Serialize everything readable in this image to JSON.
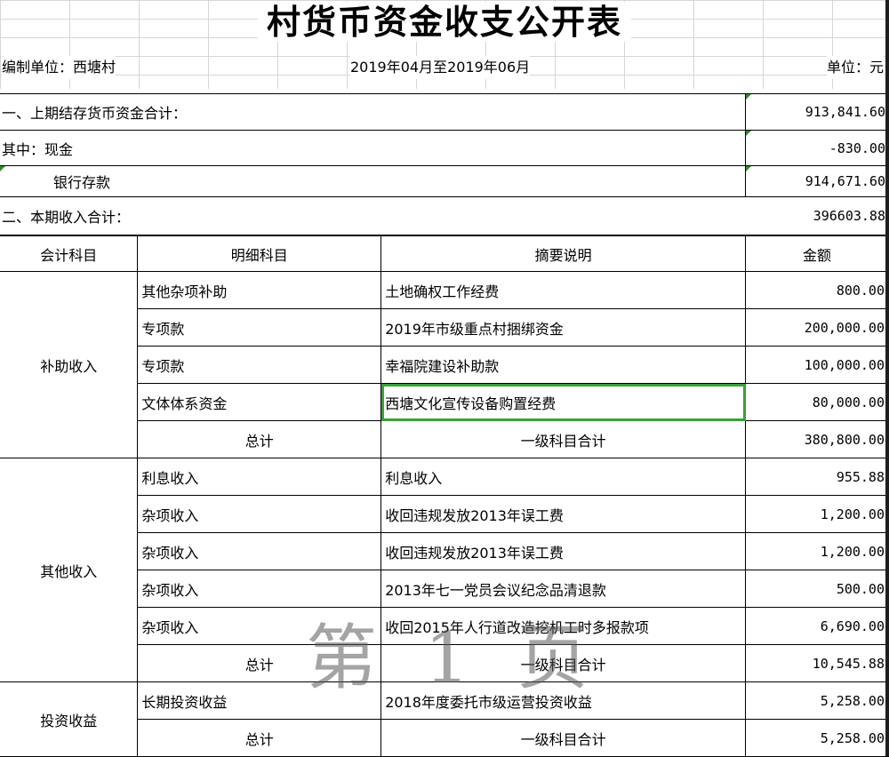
{
  "title": "村货币资金收支公开表",
  "meta": {
    "unit_org": "编制单位：西塘村",
    "period": "2019年04月至2019年06月",
    "currency_unit": "单位：元"
  },
  "summary": [
    {
      "label": "一、上期结存货币资金合计：",
      "amount": "913,841.60"
    },
    {
      "label": "其中：现金",
      "amount": "-830.00"
    },
    {
      "label": "银行存款",
      "amount": "914,671.60"
    },
    {
      "label": "二、本期收入合计：",
      "amount": "396603.88"
    }
  ],
  "table": {
    "headers": [
      "会计科目",
      "明细科目",
      "摘要说明",
      "金额"
    ],
    "groups": [
      {
        "category": "补助收入",
        "rows": [
          {
            "detail": "其他杂项补助",
            "desc": "土地确权工作经费",
            "amount": "800.00"
          },
          {
            "detail": "专项款",
            "desc": "2019年市级重点村捆绑资金",
            "amount": "200,000.00"
          },
          {
            "detail": "专项款",
            "desc": "幸福院建设补助款",
            "amount": "100,000.00"
          },
          {
            "detail": "文体体系资金",
            "desc": "西塘文化宣传设备购置经费",
            "amount": "80,000.00"
          }
        ],
        "total": {
          "label": "总计",
          "desc": "一级科目合计",
          "amount": "380,800.00"
        }
      },
      {
        "category": "其他收入",
        "rows": [
          {
            "detail": "利息收入",
            "desc": "利息收入",
            "amount": "955.88"
          },
          {
            "detail": "杂项收入",
            "desc": "收回违规发放2013年误工费",
            "amount": "1,200.00"
          },
          {
            "detail": "杂项收入",
            "desc": "收回违规发放2013年误工费",
            "amount": "1,200.00"
          },
          {
            "detail": "杂项收入",
            "desc": "2013年七一党员会议纪念品清退款",
            "amount": "500.00"
          },
          {
            "detail": "杂项收入",
            "desc": "收回2015年人行道改造挖机工时多报款项",
            "amount": "6,690.00"
          }
        ],
        "total": {
          "label": "总计",
          "desc": "一级科目合计",
          "amount": "10,545.88"
        }
      },
      {
        "category": "投资收益",
        "rows": [
          {
            "detail": "长期投资收益",
            "desc": "2018年度委托市级运营投资收益",
            "amount": "5,258.00"
          }
        ],
        "total": {
          "label": "总计",
          "desc": "一级科目合计",
          "amount": "5,258.00"
        }
      }
    ]
  },
  "watermark": "第 1 页",
  "colors": {
    "selection": "#3aa03a",
    "marker": "#2e8b2e"
  }
}
